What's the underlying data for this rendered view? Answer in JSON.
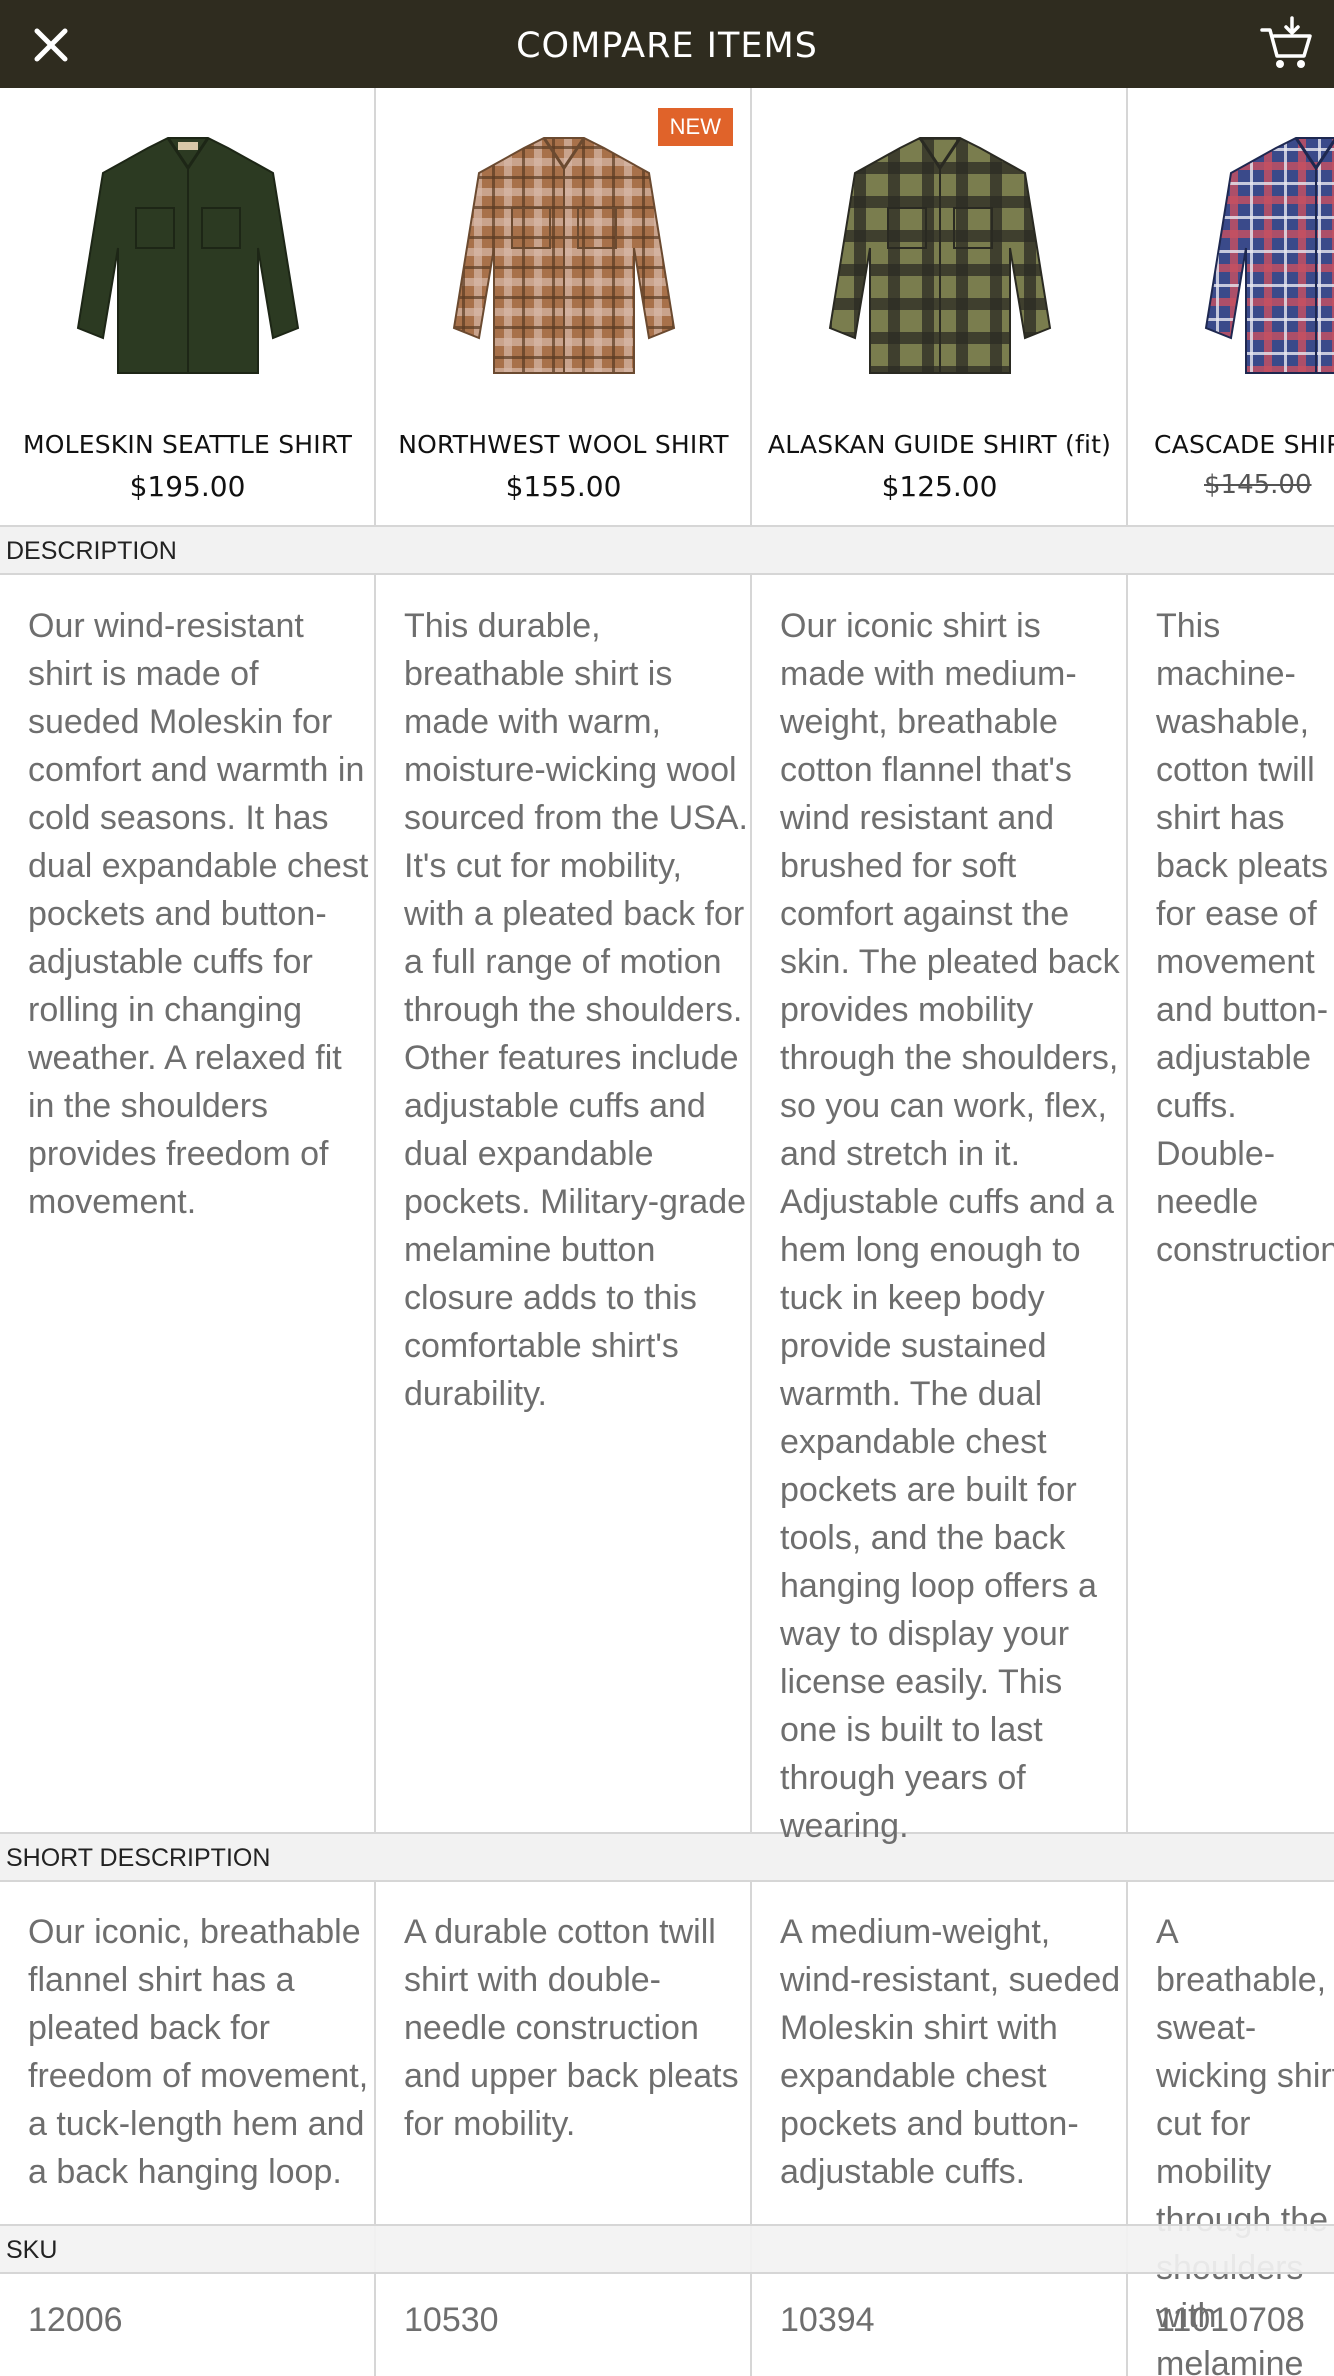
{
  "header": {
    "title": "COMPARE ITEMS",
    "close_icon": "close-icon",
    "cart_icon": "cart-add-icon"
  },
  "products": [
    {
      "name": "MOLESKIN SEATTLE SHIRT",
      "price": "$195.00",
      "badge": "",
      "shirt_color": "#2c3a22",
      "pattern": "solid",
      "description": "Our wind-resistant shirt is made of sueded Moleskin for comfort and warmth in cold seasons. It has dual expandable chest pockets and button-adjustable cuffs for rolling in changing weather. A relaxed fit in the shoulders provides freedom of movement.",
      "short_description": "Our iconic, breathable flannel shirt has a pleated back for freedom of movement, a tuck-length hem and a back hanging loop.",
      "sku": "12006"
    },
    {
      "name": "NORTHWEST WOOL SHIRT",
      "price": "$155.00",
      "badge": "NEW",
      "shirt_color": "#9a6a45",
      "pattern": "plaid-brown",
      "description": "This durable, breathable shirt is made with warm, moisture-wicking wool sourced from the USA. It's cut for mobility, with a pleated back for a full range of motion through the shoulders. Other features include adjustable cuffs and dual expandable pockets. Military-grade melamine button closure adds to this comfortable shirt's durability.",
      "short_description": "A durable cotton twill shirt with double-needle construction and upper back pleats for mobility.",
      "sku": "10530"
    },
    {
      "name": "ALASKAN GUIDE SHIRT (fit)",
      "price": "$125.00",
      "badge": "",
      "shirt_color": "#6b6e44",
      "pattern": "plaid-olive",
      "description": "Our iconic shirt is made with medium-weight, breathable cotton flannel that's wind resistant and brushed for soft comfort against the skin. The pleated back provides mobility through the shoulders, so you can work, flex, and stretch in it. Adjustable cuffs and a hem long enough to tuck in keep body provide sustained warmth. The dual expandable chest pockets are built for tools, and the back hanging loop offers a way to display your license easily. This one is built to last through years of wearing.",
      "short_description": "A medium-weight, wind-resistant, sueded Moleskin shirt with expandable chest pockets and button-adjustable cuffs.",
      "sku": "10394"
    },
    {
      "name": "CASCADE SHIRT",
      "price": "$145.00",
      "badge": "",
      "shirt_color": "#3a4a8a",
      "pattern": "plaid-blue",
      "description": "This machine-washable, cotton twill shirt has back pleats for ease of movement and button-adjustable cuffs. Double-needle construction.",
      "short_description": "A breathable, sweat-wicking shirt cut for mobility through the shoulders with melamine buttons for durability.",
      "sku": "11010708"
    }
  ],
  "sections": {
    "description": "DESCRIPTION",
    "short_description": "SHORT DESCRIPTION",
    "sku": "SKU"
  }
}
